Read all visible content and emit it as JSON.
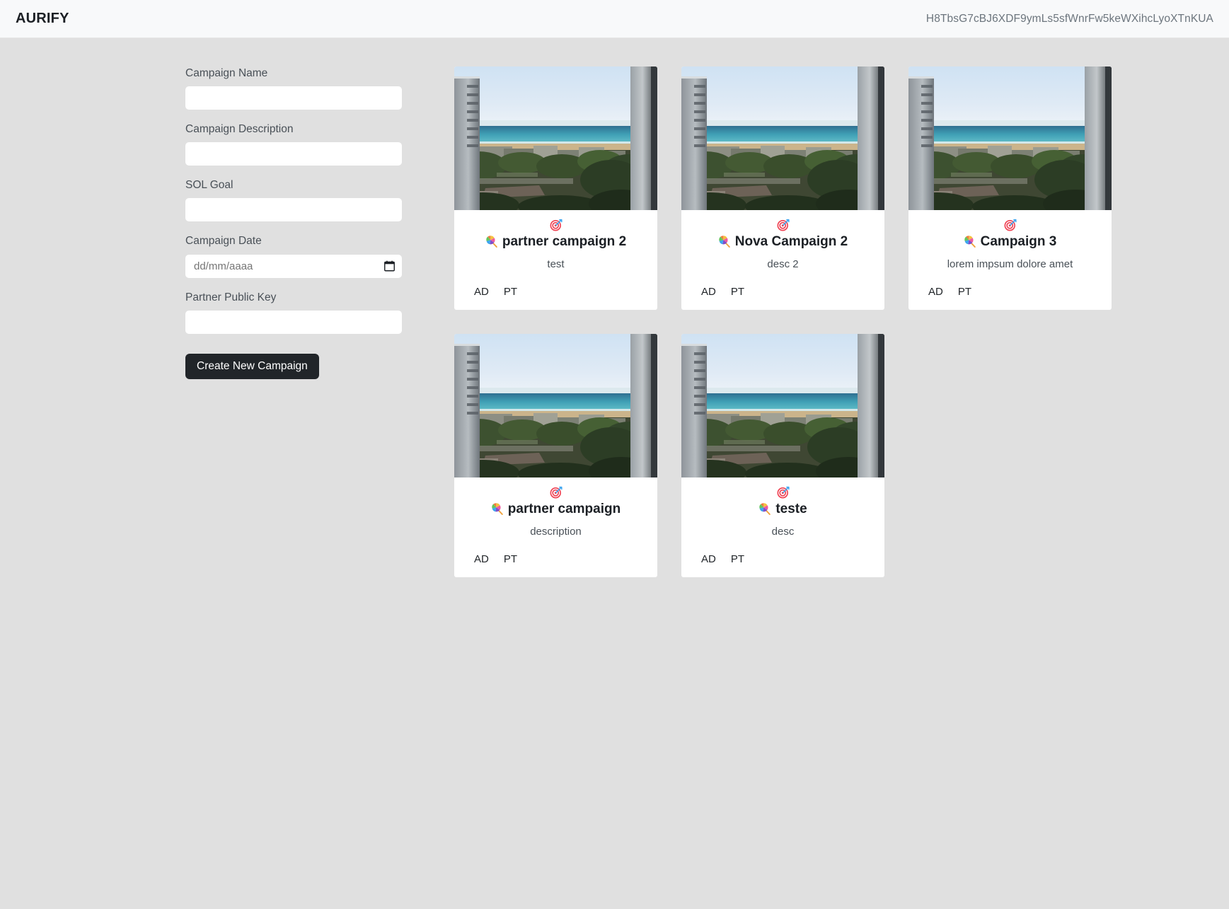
{
  "header": {
    "brand": "AURIFY",
    "wallet_address": "H8TbsG7cBJ6XDF9ymLs5sfWnrFw5keWXihcLyoXTnKUA"
  },
  "form": {
    "fields": [
      {
        "label": "Campaign Name",
        "value": "",
        "placeholder": ""
      },
      {
        "label": "Campaign Description",
        "value": "",
        "placeholder": ""
      },
      {
        "label": "SOL Goal",
        "value": "",
        "placeholder": ""
      }
    ],
    "date_field": {
      "label": "Campaign Date",
      "value": "",
      "placeholder": "dd/mm/aaaa",
      "icon": "calendar-icon"
    },
    "partner_field": {
      "label": "Partner Public Key",
      "value": "",
      "placeholder": ""
    },
    "submit_label": "Create New Campaign"
  },
  "cards": {
    "target_icon": "target-icon",
    "title_icon": "lollipop-icon",
    "action_ad": "AD",
    "action_pt": "PT",
    "items": [
      {
        "title": "partner campaign 2",
        "description": "test"
      },
      {
        "title": "Nova Campaign 2",
        "description": "desc 2"
      },
      {
        "title": "Campaign 3",
        "description": "lorem impsum dolore amet"
      },
      {
        "title": "partner campaign",
        "description": "description"
      },
      {
        "title": "teste",
        "description": "desc"
      }
    ]
  },
  "colors": {
    "page_background": "#e0e0e0",
    "header_background": "#f8f9fa",
    "card_background": "#ffffff",
    "button_background": "#212529",
    "label_text": "#495057",
    "wallet_text": "#6c757d"
  }
}
